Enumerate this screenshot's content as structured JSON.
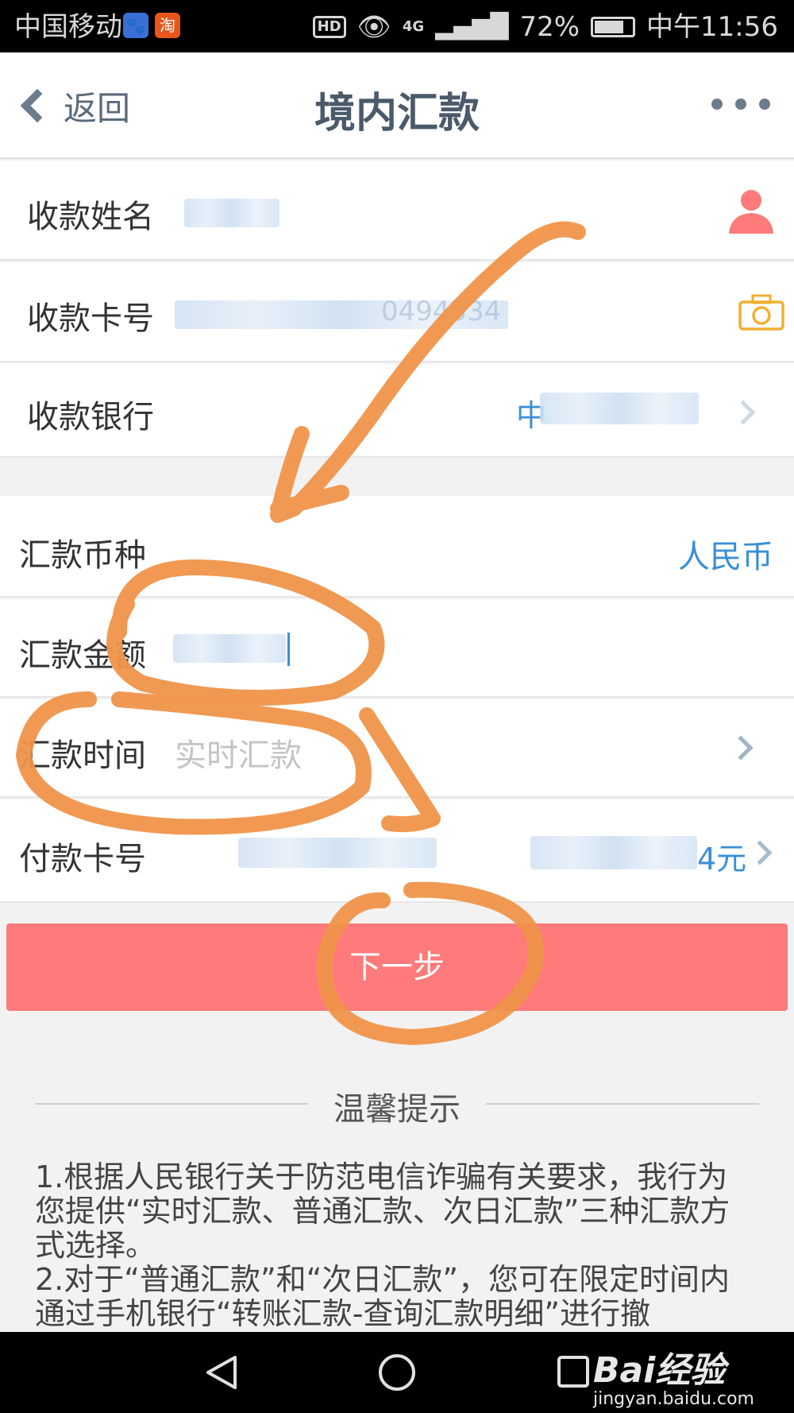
{
  "status_bar": {
    "carrier": "中国移动",
    "baidu_app": "🐾",
    "taobao_app": "淘",
    "hd": "HD",
    "network": "4G",
    "battery": "72%",
    "time": "中午11:56"
  },
  "nav": {
    "back_label": "返回",
    "title": "境内汇款"
  },
  "payee": {
    "name_label": "收款姓名",
    "card_label": "收款卡号",
    "card_visible": "0494534",
    "bank_label": "收款银行",
    "bank_visible": "中"
  },
  "remit": {
    "currency_label": "汇款币种",
    "currency_value": "人民币",
    "amount_label": "汇款金额",
    "time_label": "汇款时间",
    "time_placeholder": "实时汇款",
    "pay_card_label": "付款卡号",
    "pay_balance_suffix": "4元"
  },
  "next_button": "下一步",
  "tips": {
    "title": "温馨提示",
    "body": "1.根据人民银行关于防范电信诈骗有关要求，我行为您提供“实时汇款、普通汇款、次日汇款”三种汇款方式选择。\n2.对于“普通汇款”和“次日汇款”，您可在限定时间内通过手机银行“转账汇款-查询汇款明细”进行撤"
  },
  "watermark": {
    "logo": "Bai经验",
    "url": "jingyan.baidu.com"
  },
  "colors": {
    "next_button": "#ff7a7a",
    "accent_blue": "#3a8fd6",
    "annotation_orange": "#f0944a"
  }
}
